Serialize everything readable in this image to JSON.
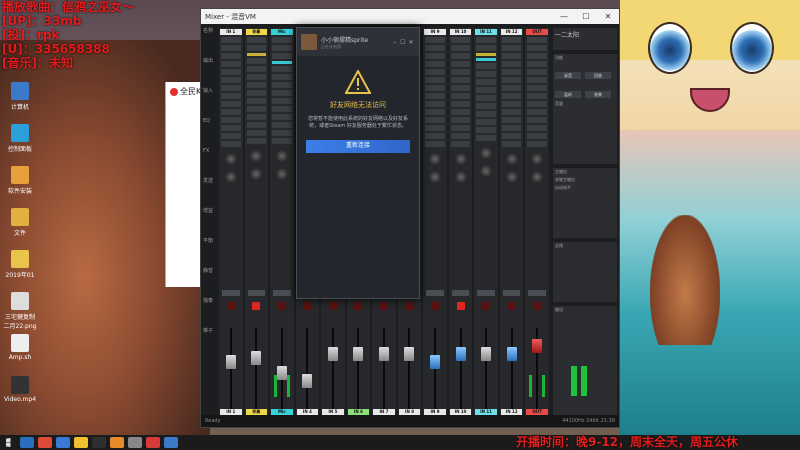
{
  "stream_overlay": {
    "line1": "播放歌曲：信鸦之巫女～",
    "line2": "[UP]：33mb",
    "line3": "[投]：rpk",
    "line4": "[U]：335658388",
    "line5": "[音乐]：未知"
  },
  "desktop_icons": [
    {
      "label": "计算机",
      "color": "#3a7ac8"
    },
    {
      "label": "控制面板",
      "color": "#2a9fd8"
    },
    {
      "label": "软件安装",
      "color": "#e8a13a"
    },
    {
      "label": "文件",
      "color": "#e0b040"
    },
    {
      "label": "2019年01",
      "color": "#e8c44a"
    },
    {
      "label": "三宅健复制二月22.png",
      "color": "#ddd"
    },
    {
      "label": "Amp.sh",
      "color": "#eee"
    },
    {
      "label": "Video.mp4",
      "color": "#333"
    }
  ],
  "bg_window": {
    "title": "全民K"
  },
  "mixer": {
    "title": "Mixer - 混音VM",
    "min": "—",
    "max": "☐",
    "close": "✕",
    "top_right_label": "一二太阳",
    "row_labels": [
      "名称",
      "输出",
      "输入",
      "EQ",
      "FX",
      "发送",
      "增益",
      "平衡",
      "静音",
      "独奏",
      "推子",
      "名称"
    ],
    "channels": [
      {
        "name": "IN 1",
        "color": "#e8e8e8",
        "bottom": "IN 1",
        "fader": 0.35,
        "fader_style": "grey",
        "rec": false,
        "meter": false
      },
      {
        "name": "伴奏",
        "color": "#f0d64a",
        "bottom": "伴奏",
        "fader": 0.3,
        "fader_style": "grey",
        "rec": true,
        "meter": false
      },
      {
        "name": "Mic",
        "color": "#3ad0d8",
        "bottom": "Mic",
        "fader": 0.5,
        "fader_style": "grey",
        "rec": false,
        "meter": true
      },
      {
        "name": "IN 4",
        "color": "#e8e8e8",
        "bottom": "IN 4",
        "fader": 0.6,
        "fader_style": "grey",
        "rec": false,
        "meter": false
      },
      {
        "name": "IN 5",
        "color": "#e8e8e8",
        "bottom": "IN 5",
        "fader": 0.25,
        "fader_style": "grey",
        "rec": false,
        "meter": false
      },
      {
        "name": "IN 6",
        "color": "#8ce07a",
        "bottom": "IN 6",
        "fader": 0.25,
        "fader_style": "grey",
        "rec": false,
        "meter": false
      },
      {
        "name": "IN 7",
        "color": "#e8e8e8",
        "bottom": "IN 7",
        "fader": 0.25,
        "fader_style": "grey",
        "rec": false,
        "meter": false
      },
      {
        "name": "IN 8",
        "color": "#e8e8e8",
        "bottom": "IN 8",
        "fader": 0.25,
        "fader_style": "grey",
        "rec": false,
        "meter": false
      },
      {
        "name": "IN 9",
        "color": "#e8e8e8",
        "bottom": "IN 9",
        "fader": 0.35,
        "fader_style": "blue",
        "rec": false,
        "meter": false
      },
      {
        "name": "IN 10",
        "color": "#e8e8e8",
        "bottom": "IN 10",
        "fader": 0.25,
        "fader_style": "blue",
        "rec": true,
        "meter": false
      },
      {
        "name": "IN 11",
        "color": "#6be0e8",
        "bottom": "IN 11",
        "fader": 0.25,
        "fader_style": "grey",
        "rec": false,
        "meter": false
      },
      {
        "name": "IN 12",
        "color": "#e8e8e8",
        "bottom": "IN 12",
        "fader": 0.25,
        "fader_style": "blue",
        "rec": false,
        "meter": false
      },
      {
        "name": "OUT",
        "color": "#e84a4a",
        "bottom": "OUT",
        "fader": 0.15,
        "fader_style": "red",
        "rec": false,
        "meter": true
      }
    ],
    "right_panel": {
      "label1": "功能",
      "label2": "音量",
      "btn_a": "录音",
      "btn_b": "回放",
      "btn_c": "监听",
      "btn_d": "效果",
      "label3": "主输出",
      "chk1": "关联主输出",
      "chk2": "自动电平",
      "label4": "总线",
      "label5": "输出"
    },
    "status_left": "Ready",
    "status_right": "44100Hz 24bit 21:38"
  },
  "steam_dialog": {
    "user": "小小宿摆精sprite",
    "status": "正在计由游",
    "title": "好友网络无法访问",
    "message": "您将暂不能使用此系统的好友网络以及好友系统，或者Steam 好友服务器处于繁忙状态。",
    "button": "重新连接"
  },
  "taskbar": {
    "ticker": "开播时间：晚9-12，周末全天，周五公休"
  }
}
